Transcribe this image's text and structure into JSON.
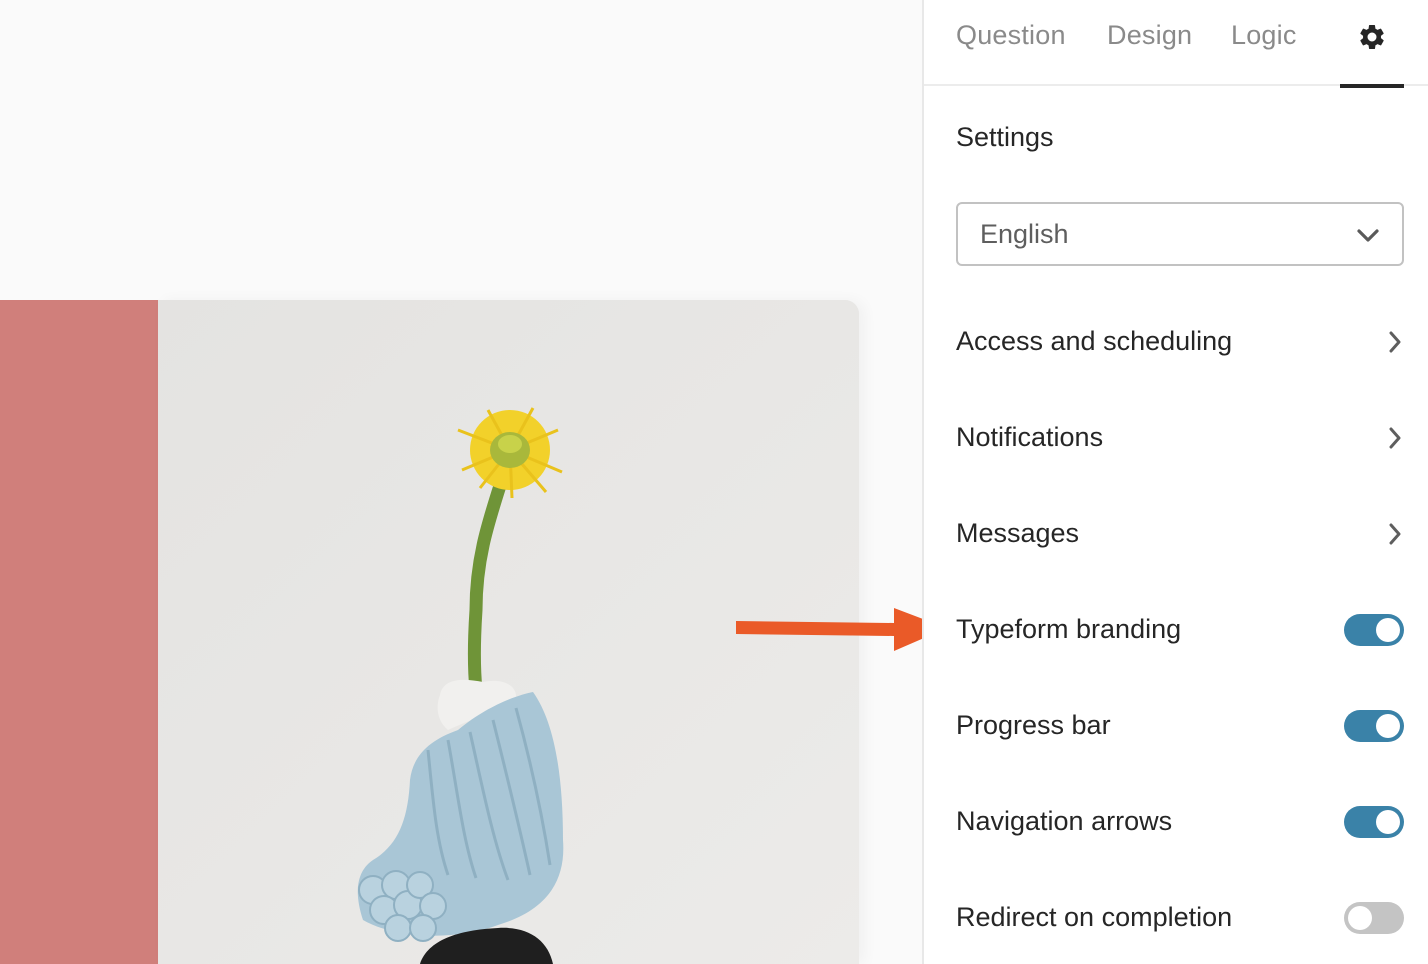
{
  "tabs": [
    {
      "label": "Question",
      "active": false
    },
    {
      "label": "Design",
      "active": false
    },
    {
      "label": "Logic",
      "active": false
    },
    {
      "label": "",
      "icon": "gear-icon",
      "active": true
    }
  ],
  "settings": {
    "title": "Settings",
    "language": {
      "selected": "English"
    },
    "nav_rows": [
      {
        "label": "Access and scheduling",
        "icon": "chevron-right-icon"
      },
      {
        "label": "Notifications",
        "icon": "chevron-right-icon"
      },
      {
        "label": "Messages",
        "icon": "chevron-right-icon"
      }
    ],
    "toggles": [
      {
        "label": "Typeform branding",
        "on": true
      },
      {
        "label": "Progress bar",
        "on": true
      },
      {
        "label": "Navigation arrows",
        "on": true
      },
      {
        "label": "Redirect on completion",
        "on": false
      }
    ]
  },
  "annotation": {
    "type": "arrow",
    "points_to": "Typeform branding",
    "color": "#ea5a28"
  },
  "colors": {
    "toggle_on": "#3a82a8",
    "toggle_off": "#c4c4c4",
    "accent_block": "#d07f7b",
    "active_tab_underline": "#262626"
  }
}
